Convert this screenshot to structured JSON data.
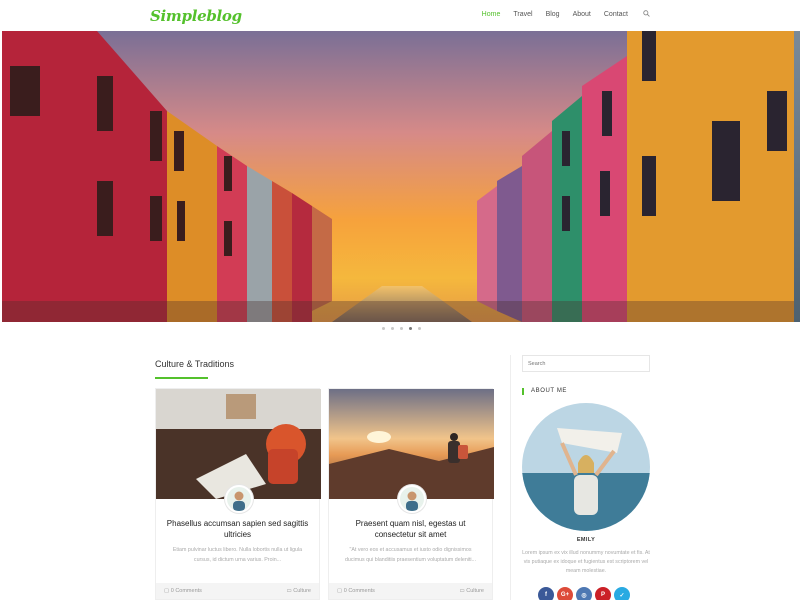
{
  "header": {
    "logo": "Simpleblog",
    "nav": [
      "Home",
      "Travel",
      "Blog",
      "About",
      "Contact"
    ],
    "active_nav": "Home",
    "search_icon": "search-icon"
  },
  "slider": {
    "dot_count": 5,
    "active_dot": 4
  },
  "section": {
    "title": "Culture & Traditions"
  },
  "cards": [
    {
      "title": "Phasellus accumsan sapien sed sagittis ultricies",
      "excerpt": "Etiam pulvinar luctus libero. Nulla lobortis nulla ut ligula cursus, id dictum urna varius. Proin...",
      "comments": "0 Comments",
      "category": "Culture"
    },
    {
      "title": "Praesent quam nisl, egestas ut consectetur sit amet",
      "excerpt": "\"At vero eos et accusamus et iusto odio dignissimos ducimus qui blanditiis praesentium voluptatum deleniti...",
      "comments": "0 Comments",
      "category": "Culture"
    }
  ],
  "sidebar": {
    "search_placeholder": "Search",
    "about_heading": "ABOUT ME",
    "name": "EMILY",
    "bio": "Lorem ipsum ex vix illud nonummy novumtate et fis. At vis putiaque ex idoque et fugientus est scriptorem vel meam molestiae.",
    "socials": [
      {
        "label": "f",
        "icon": "facebook-icon",
        "color": "#3b5998"
      },
      {
        "label": "G+",
        "icon": "google-plus-icon",
        "color": "#dd4b39"
      },
      {
        "label": "◎",
        "icon": "instagram-icon",
        "color": "#4e78b3"
      },
      {
        "label": "P",
        "icon": "pinterest-icon",
        "color": "#cb2027"
      },
      {
        "label": "✓",
        "icon": "twitter-icon",
        "color": "#29aae2"
      }
    ]
  },
  "colors": {
    "accent": "#54c12c"
  }
}
